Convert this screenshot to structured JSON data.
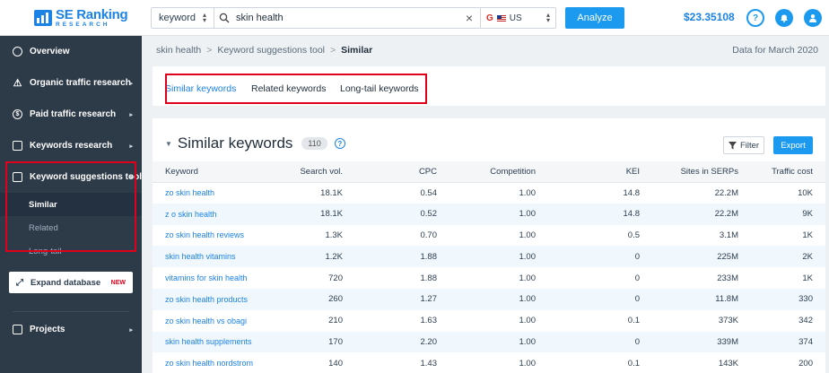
{
  "header": {
    "logo_main": "SE Ranking",
    "logo_sub": "RESEARCH",
    "search_type": "keyword",
    "search_value": "skin health",
    "region_engine": "G",
    "region_code": "US",
    "analyze_label": "Analyze",
    "balance": "$23.35108",
    "help_label": "?",
    "bell_label": "🔔",
    "user_label": "👤"
  },
  "sidebar": {
    "items": [
      {
        "label": "Overview"
      },
      {
        "label": "Organic traffic research"
      },
      {
        "label": "Paid traffic research"
      },
      {
        "label": "Keywords research"
      },
      {
        "label": "Keyword suggestions tool"
      }
    ],
    "subitems": [
      {
        "label": "Similar"
      },
      {
        "label": "Related"
      },
      {
        "label": "Long-tail"
      }
    ],
    "expand_label": "Expand database",
    "expand_badge": "NEW",
    "projects_label": "Projects"
  },
  "breadcrumb": {
    "items": [
      "skin health",
      "Keyword suggestions tool",
      "Similar"
    ],
    "separator": ">",
    "date": "Data for March 2020"
  },
  "tabs": [
    "Similar keywords",
    "Related keywords",
    "Long-tail keywords"
  ],
  "section": {
    "title": "Similar keywords",
    "count": "110",
    "filter_label": "Filter",
    "export_label": "Export"
  },
  "table": {
    "columns": [
      "Keyword",
      "Search vol.",
      "CPC",
      "Competition",
      "KEI",
      "Sites in SERPs",
      "Traffic cost"
    ],
    "rows": [
      [
        "zo skin health",
        "18.1K",
        "0.54",
        "1.00",
        "14.8",
        "22.2M",
        "10K"
      ],
      [
        "z o skin health",
        "18.1K",
        "0.52",
        "1.00",
        "14.8",
        "22.2M",
        "9K"
      ],
      [
        "zo skin health reviews",
        "1.3K",
        "0.70",
        "1.00",
        "0.5",
        "3.1M",
        "1K"
      ],
      [
        "skin health vitamins",
        "1.2K",
        "1.88",
        "1.00",
        "0",
        "225M",
        "2K"
      ],
      [
        "vitamins for skin health",
        "720",
        "1.88",
        "1.00",
        "0",
        "233M",
        "1K"
      ],
      [
        "zo skin health products",
        "260",
        "1.27",
        "1.00",
        "0",
        "11.8M",
        "330"
      ],
      [
        "zo skin health vs obagi",
        "210",
        "1.63",
        "1.00",
        "0.1",
        "373K",
        "342"
      ],
      [
        "skin health supplements",
        "170",
        "2.20",
        "1.00",
        "0",
        "339M",
        "374"
      ],
      [
        "zo skin health nordstrom",
        "140",
        "1.43",
        "1.00",
        "0.1",
        "143K",
        "200"
      ]
    ]
  },
  "colors": {
    "accent": "#1b9af0",
    "link": "#1b82e6",
    "sidebar_bg": "#2d3a48",
    "highlight_border": "#e0001b"
  }
}
